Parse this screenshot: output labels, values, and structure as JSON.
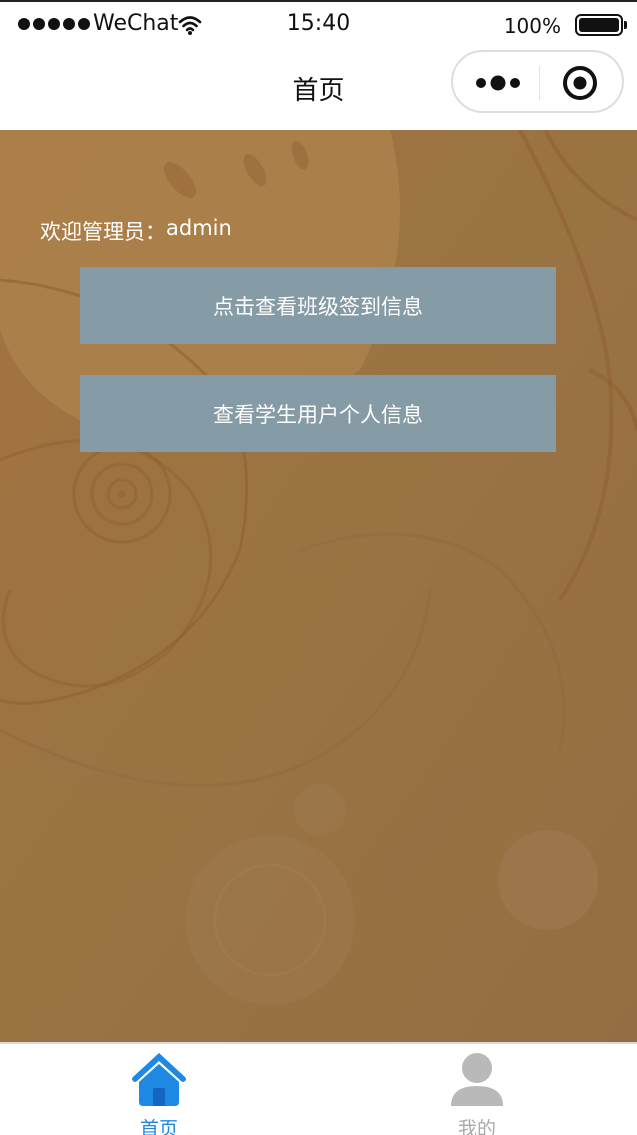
{
  "status_bar": {
    "carrier": "WeChat",
    "time": "15:40",
    "battery": "100%"
  },
  "nav": {
    "title": "首页"
  },
  "main": {
    "welcome_prefix": "欢迎管理员：",
    "username": "admin",
    "buttons": [
      {
        "label": "点击查看班级签到信息"
      },
      {
        "label": "查看学生用户个人信息"
      }
    ]
  },
  "tabbar": {
    "items": [
      {
        "label": "首页",
        "icon": "home-icon",
        "active": true,
        "color": "#1e88e5"
      },
      {
        "label": "我的",
        "icon": "user-icon",
        "active": false,
        "color": "#aaaaaa"
      }
    ]
  },
  "colors": {
    "background": "#98703f",
    "button": "#859ba5",
    "accent": "#1e88e5"
  }
}
